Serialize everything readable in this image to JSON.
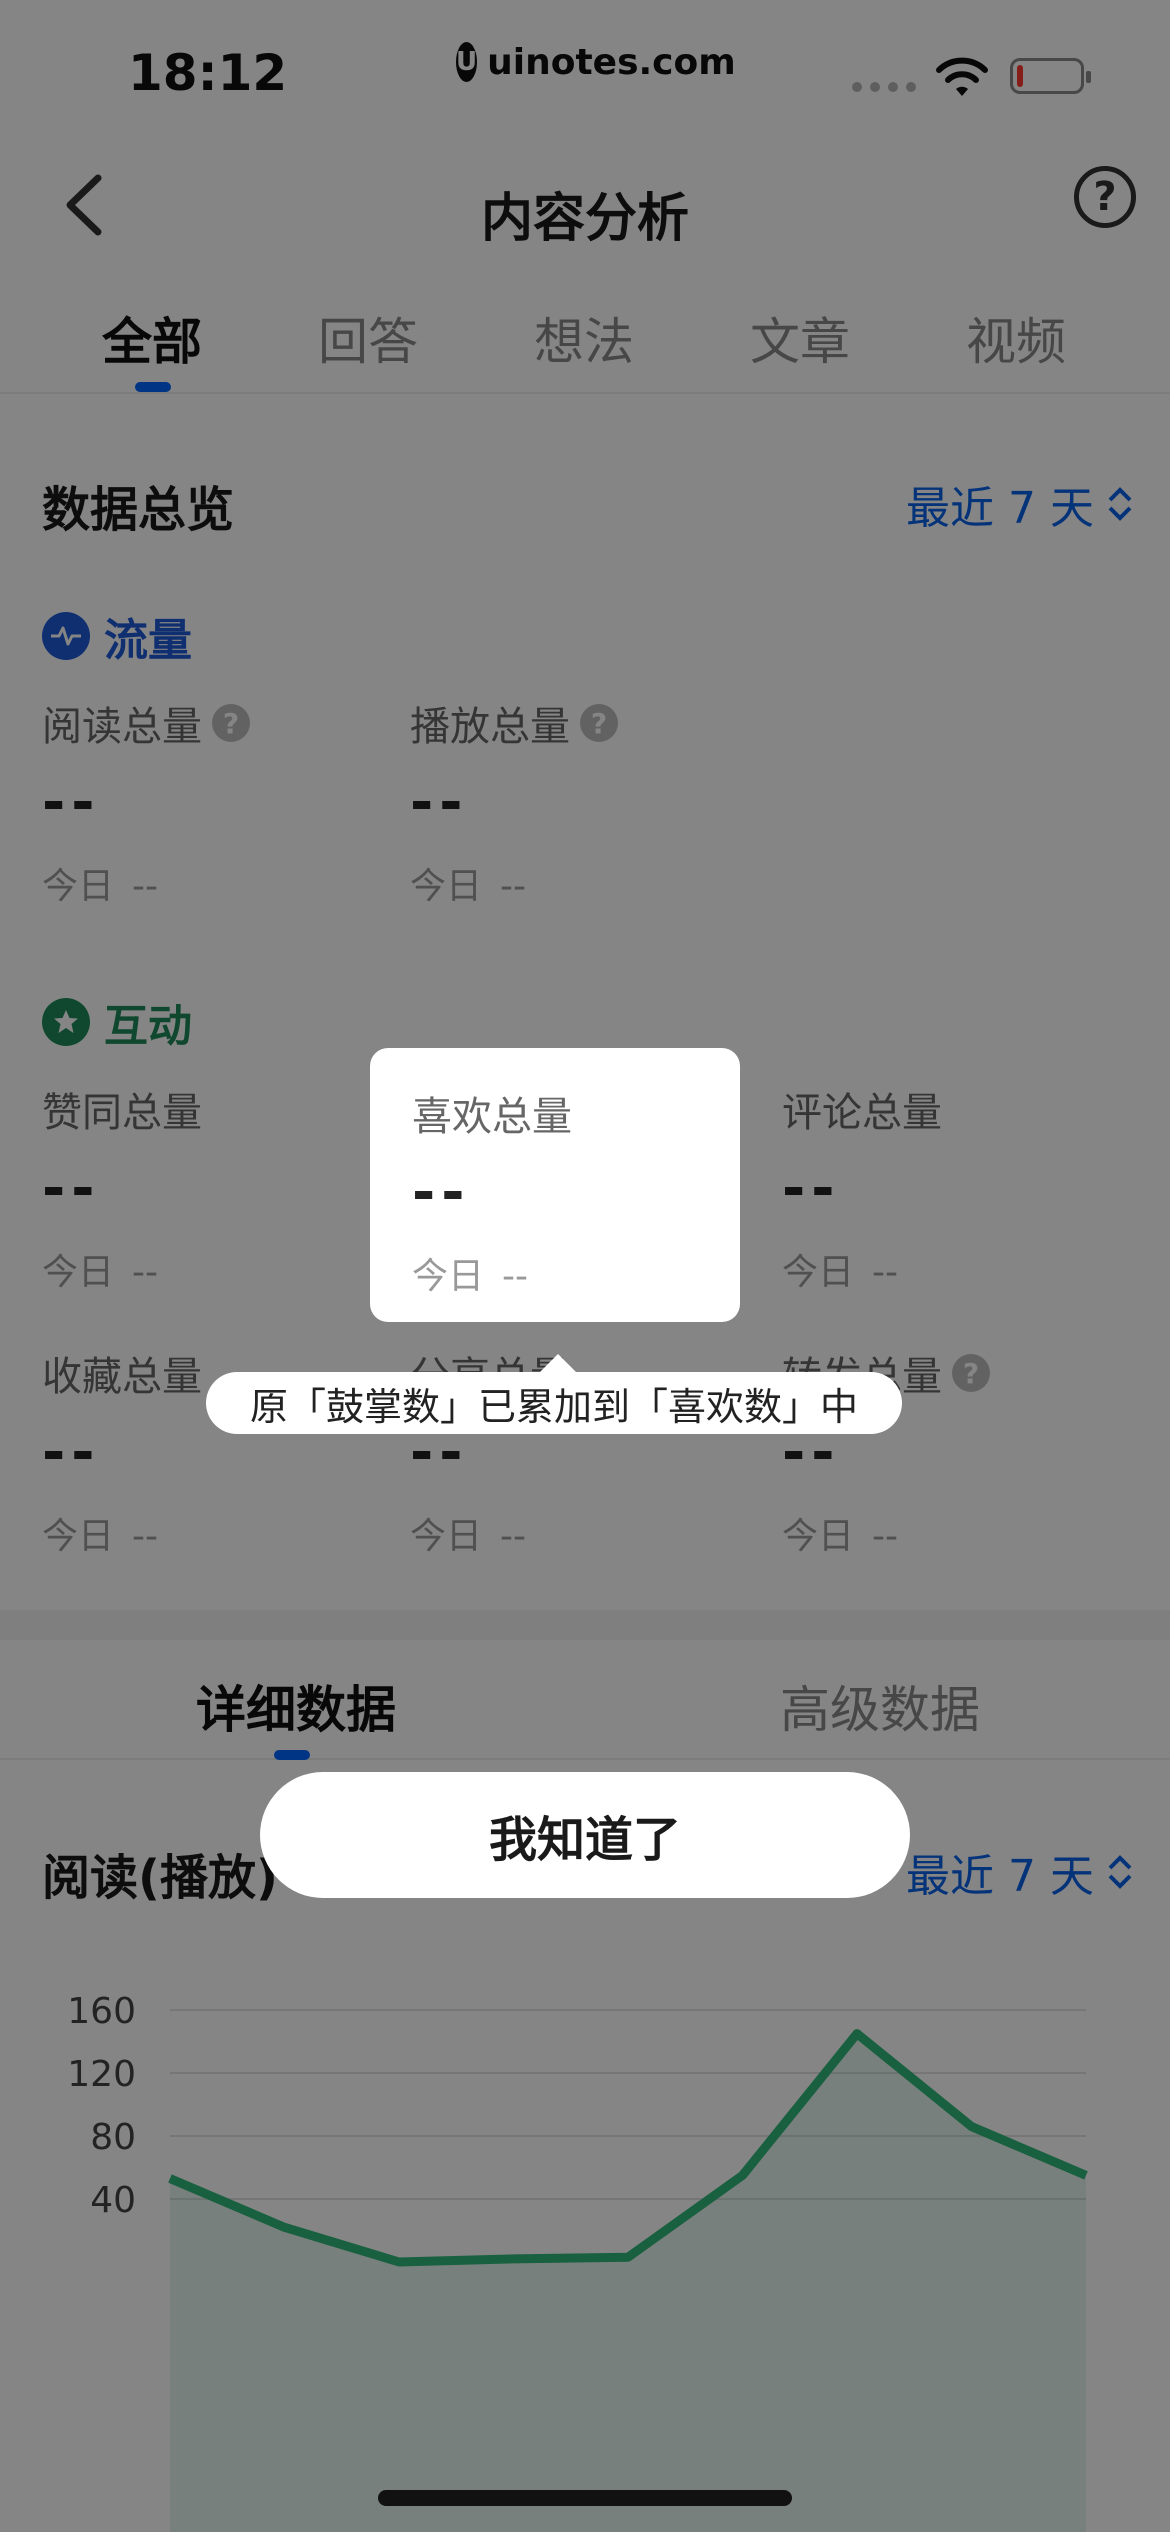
{
  "status_bar": {
    "time": "18:12",
    "watermark": "uinotes.com",
    "watermark_logo": "U"
  },
  "header": {
    "title": "内容分析",
    "help": "?"
  },
  "tabs": [
    {
      "label": "全部",
      "active": true
    },
    {
      "label": "回答",
      "active": false
    },
    {
      "label": "想法",
      "active": false
    },
    {
      "label": "文章",
      "active": false
    },
    {
      "label": "视频",
      "active": false
    }
  ],
  "overview": {
    "title": "数据总览",
    "range": "最近 7 天",
    "traffic": {
      "title": "流量",
      "color": "#1e5bd6",
      "metrics": [
        {
          "label": "阅读总量",
          "value": "--",
          "today_label": "今日",
          "today_value": "--"
        },
        {
          "label": "播放总量",
          "value": "--",
          "today_label": "今日",
          "today_value": "--"
        }
      ]
    },
    "interaction": {
      "title": "互动",
      "color": "#1f8a5b",
      "metrics": [
        {
          "label": "赞同总量",
          "value": "--",
          "today_label": "今日",
          "today_value": "--"
        },
        {
          "label": "喜欢总量",
          "value": "--",
          "today_label": "今日",
          "today_value": "--"
        },
        {
          "label": "评论总量",
          "value": "--",
          "today_label": "今日",
          "today_value": "--"
        },
        {
          "label": "收藏总量",
          "value": "--",
          "today_label": "今日",
          "today_value": "--"
        },
        {
          "label": "分享总量",
          "value": "--",
          "today_label": "今日",
          "today_value": "--"
        },
        {
          "label": "转发总量",
          "value": "--",
          "today_label": "今日",
          "today_value": "--"
        }
      ]
    }
  },
  "detail": {
    "tabs": [
      {
        "label": "详细数据",
        "active": true
      },
      {
        "label": "高级数据",
        "active": false
      }
    ],
    "chart_title": "阅读(播放)",
    "range": "最近 7 天"
  },
  "chart_data": {
    "type": "area",
    "title": "",
    "xlabel": "",
    "ylabel": "",
    "y_ticks": [
      40,
      80,
      120,
      160
    ],
    "ylim": [
      0,
      160
    ],
    "grid": true,
    "series": [
      {
        "values": [
          53,
          22,
          0,
          2,
          3,
          55,
          145,
          86,
          55
        ],
        "color": "#2fb97a"
      }
    ]
  },
  "guide": {
    "tip": "原「鼓掌数」已累加到「喜欢数」中",
    "confirm": "我知道了"
  }
}
